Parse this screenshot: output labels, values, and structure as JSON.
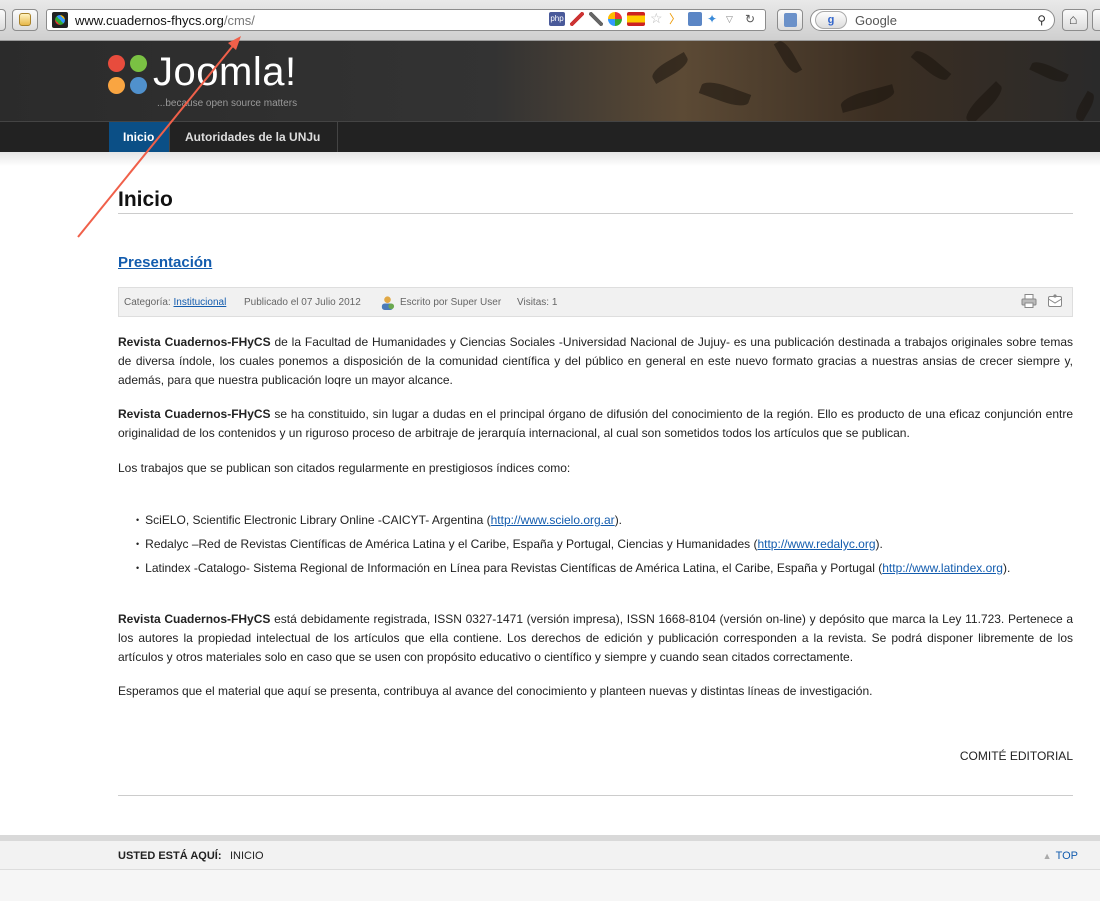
{
  "browser": {
    "url_host": "www.cuadernos-fhycs.org",
    "url_path": "/cms/",
    "search_placeholder": "Google",
    "search_engine_badge": "g"
  },
  "site": {
    "logo_text": "Joomla!",
    "logo_tagline": "...because open source matters",
    "nav": [
      {
        "label": "Inicio",
        "active": true
      },
      {
        "label": "Autoridades de la UNJu",
        "active": false
      }
    ]
  },
  "page": {
    "title": "Inicio",
    "article": {
      "title": "Presentación",
      "meta": {
        "category_label": "Categoría:",
        "category": "Institucional",
        "published": "Publicado el 07 Julio 2012",
        "author": "Escrito por Super User",
        "hits": "Visitas: 1"
      },
      "p1_strong": "Revista Cuadernos-FHyCS",
      "p1_rest": " de la Facultad de Humanidades y Ciencias Sociales -Universidad Nacional de Jujuy- es una publicación destinada a trabajos originales sobre temas de diversa índole, los cuales ponemos a disposición de la comunidad científica y del público en general en este nuevo formato gracias a nuestras ansias de crecer siempre y, además, para que nuestra publicación loqre un mayor alcance.",
      "p2_strong": "Revista Cuadernos-FHyCS",
      "p2_rest": " se ha constituido, sin lugar a dudas en el principal órgano de difusión del conocimiento de la región. Ello es producto de una eficaz conjunción entre originalidad de los contenidos y un riguroso proceso de arbitraje de jerarquía internacional, al cual son sometidos todos los artículos que se publican.",
      "p3": "Los trabajos que se publican son citados regularmente en prestigiosos índices como:",
      "list": [
        {
          "text": "SciELO, Scientific Electronic Library Online -CAICYT- Argentina (",
          "link": "http://www.scielo.org.ar",
          "after": ")."
        },
        {
          "text": "Redalyc –Red de Revistas Científicas de América Latina y el Caribe, España y Portugal, Ciencias y Humanidades (",
          "link": "http://www.redalyc.org",
          "after": ")."
        },
        {
          "text": "Latindex -Catalogo- Sistema Regional de Información en Línea para Revistas Científicas de América Latina, el Caribe, España y Portugal (",
          "link": "http://www.latindex.org",
          "after": ")."
        }
      ],
      "p4_strong": "Revista Cuadernos-FHyCS",
      "p4_rest": " está debidamente registrada, ISSN 0327-1471 (versión impresa), ISSN 1668-8104 (versión on-line) y depósito que marca la Ley 11.723. Pertenece a los autores la propiedad intelectual de los artículos que ella contiene. Los derechos de edición y publicación corresponden a la revista. Se podrá disponer libremente de los artículos y otros materiales solo en caso que se usen con propósito educativo o científico y siempre y cuando sean citados correctamente.",
      "p5": "Esperamos que el material que aquí se presenta, contribuya al avance del conocimiento y planteen nuevas y distintas líneas de investigación.",
      "signature": "COMITÉ EDITORIAL"
    }
  },
  "footer": {
    "breadcrumb_label": "USTED ESTÁ AQUÍ:",
    "breadcrumb_current": "INICIO",
    "top_link": "TOP"
  },
  "colors": {
    "nav_active": "#0b4f86",
    "link": "#135cae",
    "annotation_arrow": "#f0604a"
  }
}
